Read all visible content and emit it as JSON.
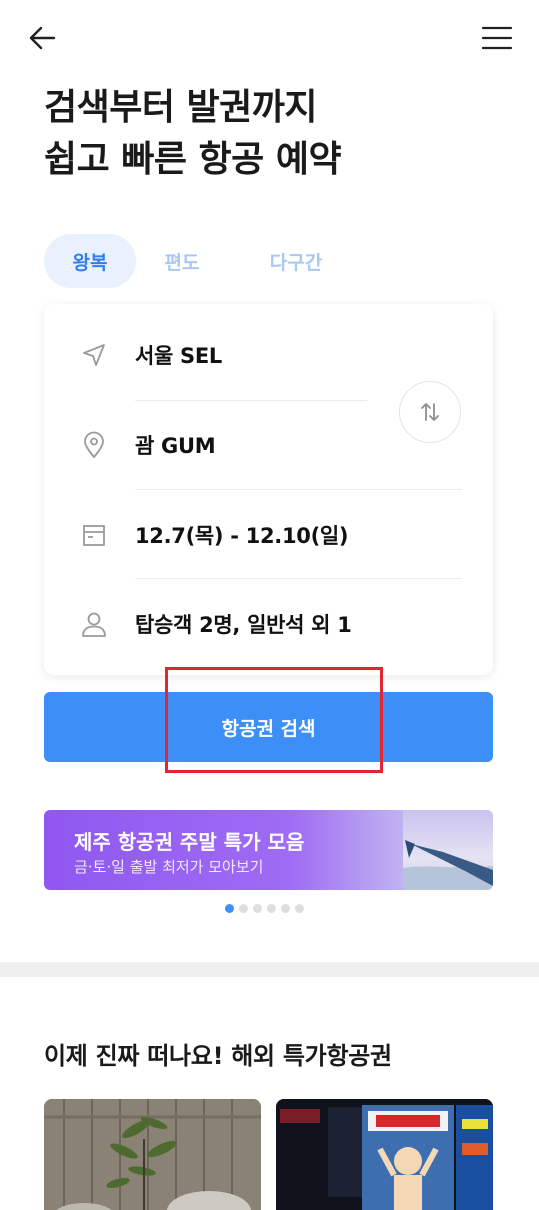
{
  "header": {
    "back_icon": "arrow-left-icon",
    "menu_icon": "hamburger-menu-icon"
  },
  "headline": {
    "line1": "검색부터 발권까지",
    "line2": "쉽고 빠른 항공 예약"
  },
  "tabs": [
    {
      "label": "왕복",
      "active": true
    },
    {
      "label": "편도",
      "active": false
    },
    {
      "label": "다구간",
      "active": false
    }
  ],
  "search_form": {
    "origin": {
      "icon": "navigation-arrow-icon",
      "value": "서울 SEL"
    },
    "destination": {
      "icon": "location-pin-icon",
      "value": "괌 GUM"
    },
    "dates": {
      "icon": "calendar-icon",
      "value": "12.7(목) - 12.10(일)"
    },
    "passengers": {
      "icon": "person-icon",
      "value": "탑승객 2명, 일반석 외 1"
    },
    "swap_icon": "swap-arrows-icon"
  },
  "search_button": {
    "label": "항공권 검색"
  },
  "banner": {
    "title": "제주 항공권 주말 특가 모음",
    "subtitle": "금·토·일 출발 최저가 모아보기"
  },
  "carousel": {
    "total": 6,
    "active_index": 0
  },
  "deals_section": {
    "title": "이제 진짜 떠나요! 해외 특가항공권"
  },
  "colors": {
    "primary": "#3d8ef7",
    "tab_active_bg": "#e8f1fd",
    "tab_inactive": "#a8c8f2",
    "highlight": "#e0262f",
    "banner_purple": "#8f57f0"
  }
}
